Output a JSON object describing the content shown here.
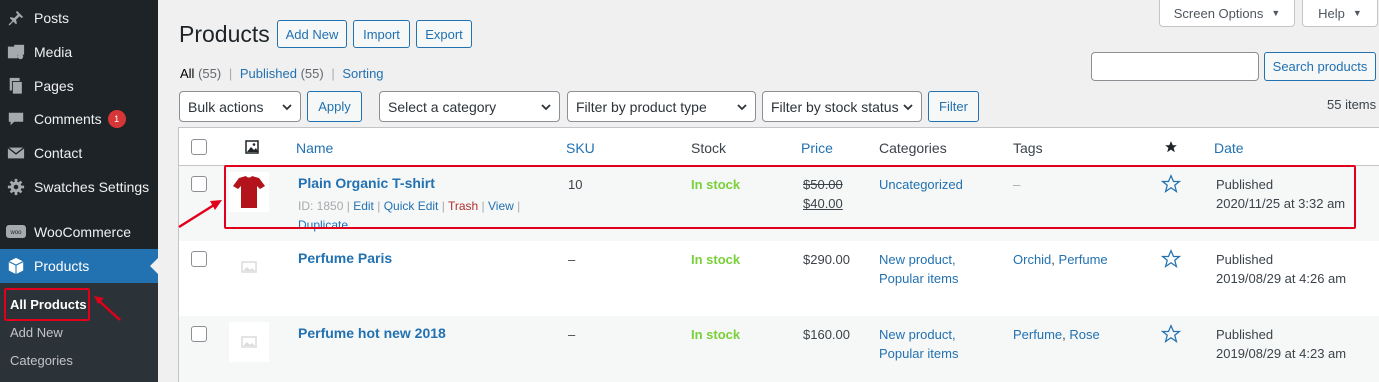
{
  "sidebar": {
    "items": [
      {
        "label": "Posts",
        "icon": "pin-icon"
      },
      {
        "label": "Media",
        "icon": "media-icon"
      },
      {
        "label": "Pages",
        "icon": "pages-icon"
      },
      {
        "label": "Comments",
        "icon": "comment-icon",
        "badge": "1"
      },
      {
        "label": "Contact",
        "icon": "mail-icon"
      },
      {
        "label": "Swatches Settings",
        "icon": "gear-icon"
      },
      {
        "label": "WooCommerce",
        "icon": "woo-icon"
      },
      {
        "label": "Products",
        "icon": "box-icon"
      }
    ],
    "submenu": [
      "All Products",
      "Add New",
      "Categories"
    ]
  },
  "screen_options": "Screen Options",
  "help": "Help",
  "title": "Products",
  "buttons": {
    "add_new": "Add New",
    "import": "Import",
    "export": "Export"
  },
  "views": {
    "all": "All",
    "all_count": "(55)",
    "published": "Published",
    "published_count": "(55)",
    "sorting": "Sorting",
    "sep": "|"
  },
  "search": {
    "button": "Search products",
    "value": ""
  },
  "filters": {
    "bulk": "Bulk actions",
    "apply": "Apply",
    "category": "Select a category",
    "type": "Filter by product type",
    "stock": "Filter by stock status",
    "filter": "Filter"
  },
  "items_count": "55 items",
  "columns": {
    "name": "Name",
    "sku": "SKU",
    "stock": "Stock",
    "price": "Price",
    "categories": "Categories",
    "tags": "Tags",
    "date": "Date"
  },
  "rows": [
    {
      "name": "Plain Organic T-shirt",
      "actions": {
        "id": "ID: 1850",
        "edit": "Edit",
        "quick_edit": "Quick Edit",
        "trash": "Trash",
        "view": "View",
        "duplicate": "Duplicate"
      },
      "sku": "10",
      "stock": "In stock",
      "price_old": "$50.00",
      "price": "$40.00",
      "categories": "Uncategorized",
      "tags": "–",
      "status": "Published",
      "date": "2020/11/25 at 3:32 am"
    },
    {
      "name": "Perfume Paris",
      "sku": "–",
      "stock": "In stock",
      "price": "$290.00",
      "categories_1": "New product,",
      "categories_2": "Popular items",
      "tag_1": "Orchid",
      "tag_2": "Perfume",
      "status": "Published",
      "date": "2019/08/29 at 4:26 am"
    },
    {
      "name": "Perfume hot new 2018",
      "sku": "–",
      "stock": "In stock",
      "price": "$160.00",
      "categories_1": "New product,",
      "categories_2": "Popular items",
      "tag_1": "Perfume",
      "tag_2": "Rose",
      "status": "Published",
      "date": "2019/08/29 at 4:23 am"
    }
  ],
  "colors": {
    "accent": "#2271b1",
    "instock": "#7ad03a",
    "highlight": "#e0001b",
    "trash": "#b32d2e"
  }
}
